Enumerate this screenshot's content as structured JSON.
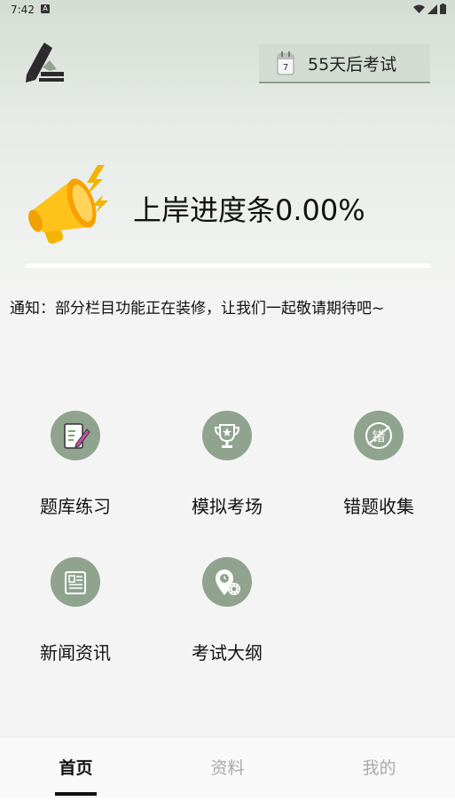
{
  "status_bar": {
    "time": "7:42"
  },
  "header": {
    "exam_countdown_label": "55天后考试",
    "calendar_day": "7"
  },
  "progress": {
    "title": "上岸进度条0.00%",
    "value": 0.0
  },
  "notice": "通知：部分栏目功能正在装修，让我们一起敬请期待吧~",
  "menu": [
    {
      "label": "题库练习",
      "icon": "notepad-pen-icon"
    },
    {
      "label": "模拟考场",
      "icon": "trophy-icon"
    },
    {
      "label": "错题收集",
      "icon": "wrong-stamp-icon"
    },
    {
      "label": "新闻资讯",
      "icon": "newspaper-icon"
    },
    {
      "label": "考试大纲",
      "icon": "location-gear-icon"
    }
  ],
  "tabs": [
    {
      "label": "首页",
      "active": true
    },
    {
      "label": "资料",
      "active": false
    },
    {
      "label": "我的",
      "active": false
    }
  ],
  "colors": {
    "accent": "#8fa38e",
    "header_bg": "#d4ddd3",
    "active_tab": "#111111",
    "inactive_tab": "#aaaaaa"
  }
}
